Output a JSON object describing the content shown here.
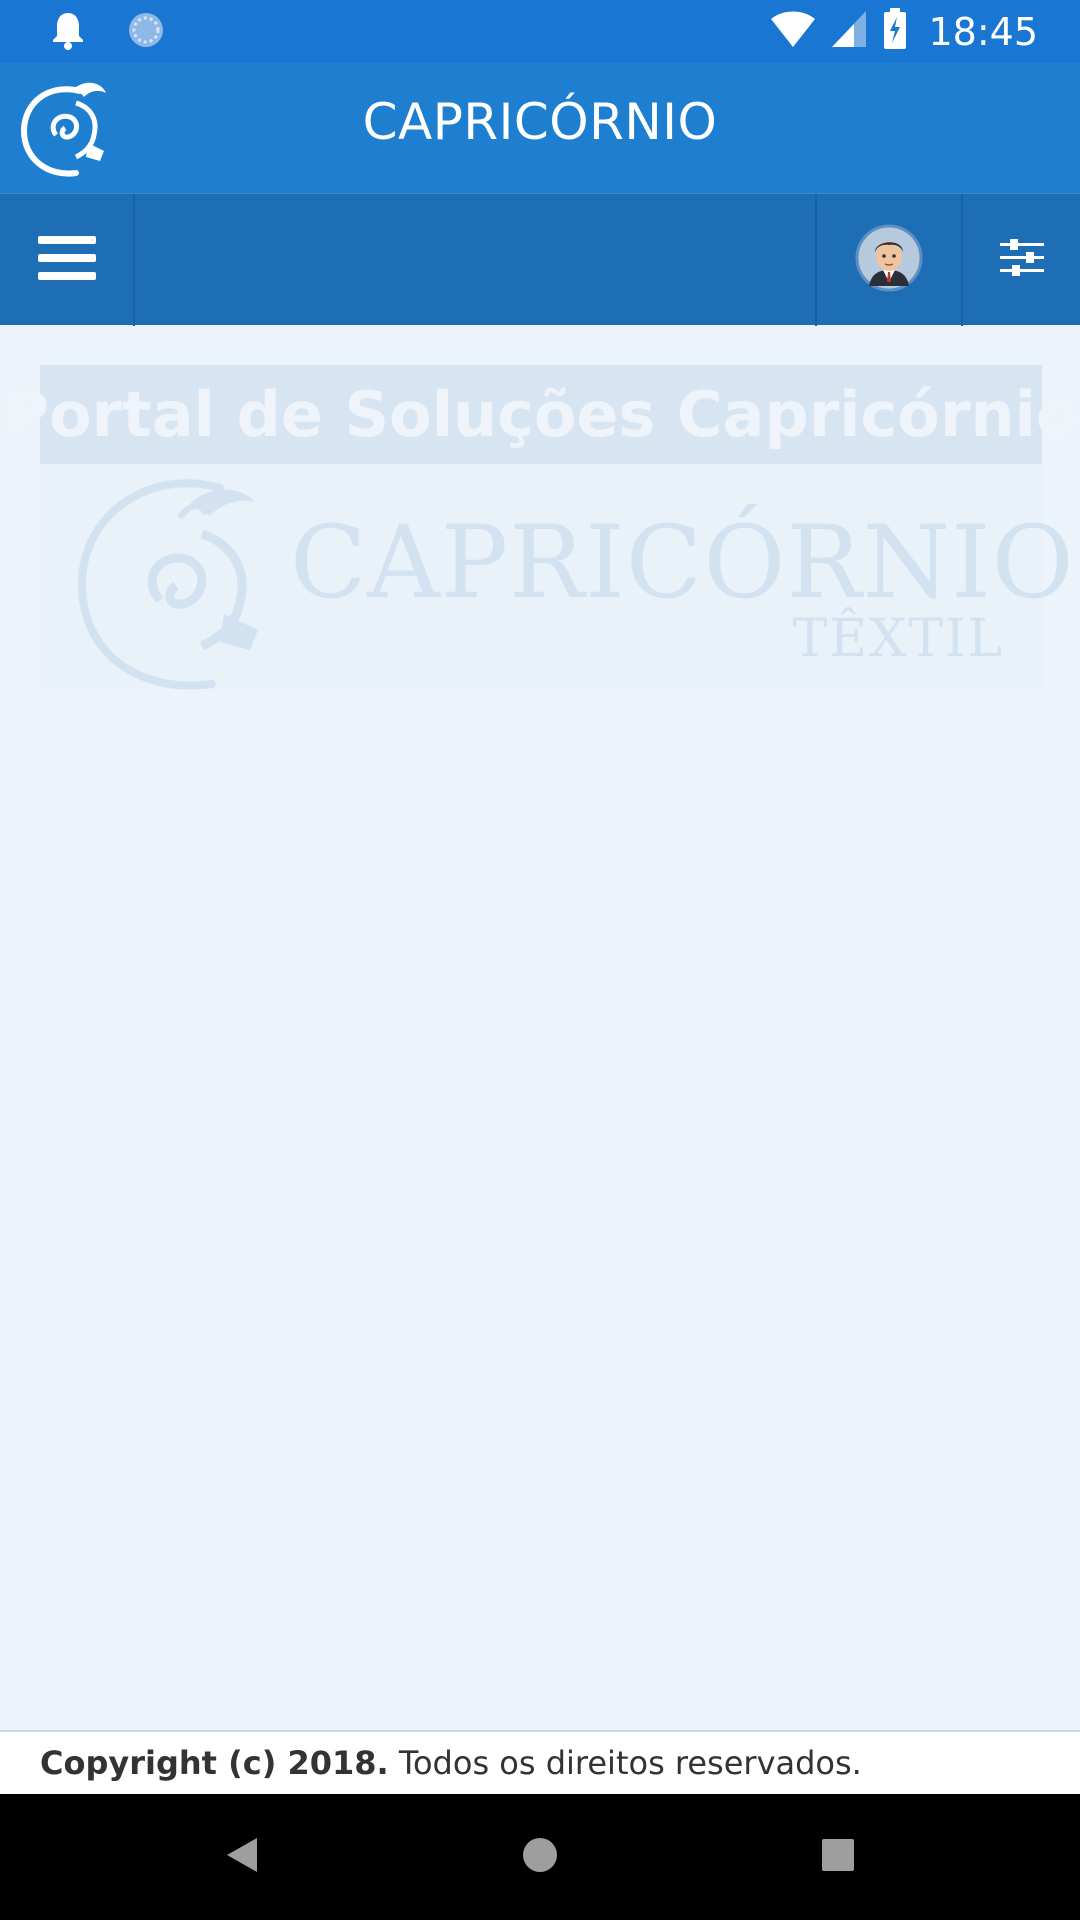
{
  "status_bar": {
    "time": "18:45",
    "icons": [
      "bell-icon",
      "sync-icon",
      "wifi-icon",
      "signal-icon",
      "battery-charging-icon"
    ]
  },
  "app_header": {
    "title": "CAPRICÓRNIO",
    "logo_icon": "capricorn-logo-icon"
  },
  "toolbar": {
    "menu_icon": "hamburger-menu-icon",
    "avatar_icon": "user-avatar-icon",
    "filter_icon": "sliders-icon"
  },
  "content": {
    "heading": "Portal de Soluções Capricórnio",
    "brand_name": "CAPRICÓRNIO",
    "brand_sub": "TÊXTIL"
  },
  "footer": {
    "copyright": "Copyright (c) 2018.",
    "rights": " Todos os direitos reservados."
  },
  "colors": {
    "status_bar": "#1976d2",
    "app_header": "#1e7fd1",
    "toolbar": "#1e6eb5",
    "page_bg": "#ecf3fb"
  }
}
